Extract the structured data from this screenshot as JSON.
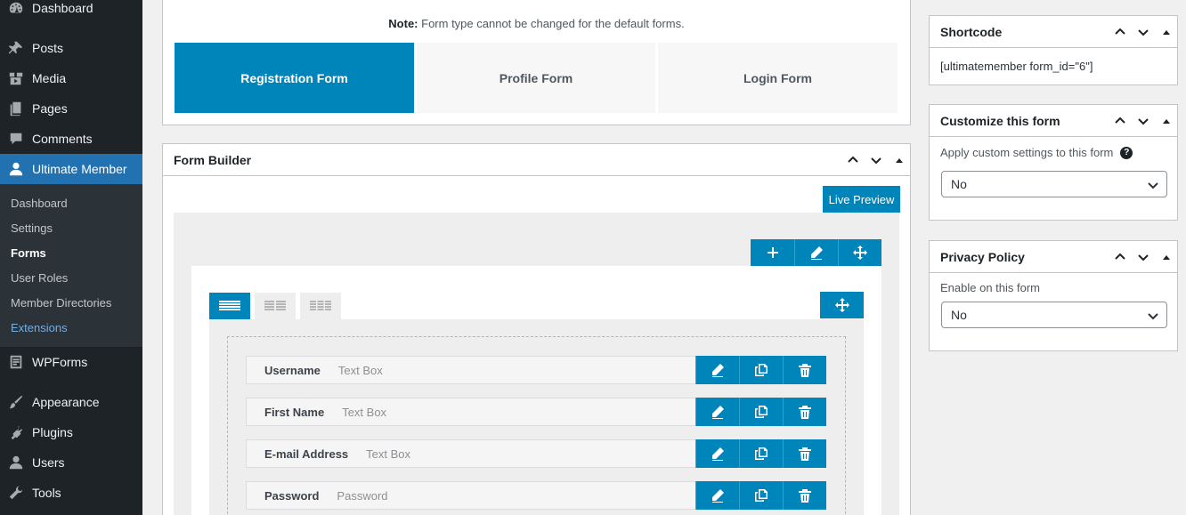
{
  "sidebar": {
    "items_top": [
      {
        "label": "Dashboard",
        "icon": "dashboard-icon"
      },
      {
        "label": "Posts",
        "icon": "pin-icon"
      },
      {
        "label": "Media",
        "icon": "media-icon"
      },
      {
        "label": "Pages",
        "icon": "pages-icon"
      },
      {
        "label": "Comments",
        "icon": "comment-icon"
      },
      {
        "label": "Ultimate Member",
        "icon": "user-icon"
      }
    ],
    "submenu": [
      "Dashboard",
      "Settings",
      "Forms",
      "User Roles",
      "Member Directories",
      "Extensions"
    ],
    "items_bottom": [
      {
        "label": "WPForms",
        "icon": "wpforms-icon"
      },
      {
        "label": "Appearance",
        "icon": "brush-icon"
      },
      {
        "label": "Plugins",
        "icon": "plugin-icon"
      },
      {
        "label": "Users",
        "icon": "users-icon"
      },
      {
        "label": "Tools",
        "icon": "wrench-icon"
      }
    ]
  },
  "form_type": {
    "note_bold": "Note:",
    "note_text": " Form type cannot be changed for the default forms.",
    "tabs": [
      "Registration Form",
      "Profile Form",
      "Login Form"
    ]
  },
  "builder": {
    "title": "Form Builder",
    "live_preview": "Live Preview",
    "fields": [
      {
        "label": "Username",
        "type": "Text Box"
      },
      {
        "label": "First Name",
        "type": "Text Box"
      },
      {
        "label": "E-mail Address",
        "type": "Text Box"
      },
      {
        "label": "Password",
        "type": "Password"
      }
    ]
  },
  "shortcode": {
    "title": "Shortcode",
    "value": "[ultimatemember form_id=\"6\"]"
  },
  "customize": {
    "title": "Customize this form",
    "label": "Apply custom settings to this form",
    "value": "No"
  },
  "privacy": {
    "title": "Privacy Policy",
    "label": "Enable on this form",
    "value": "No"
  },
  "colors": {
    "primary": "#0085ba",
    "sidebar": "#1d2327",
    "menu_current": "#2271b1"
  }
}
